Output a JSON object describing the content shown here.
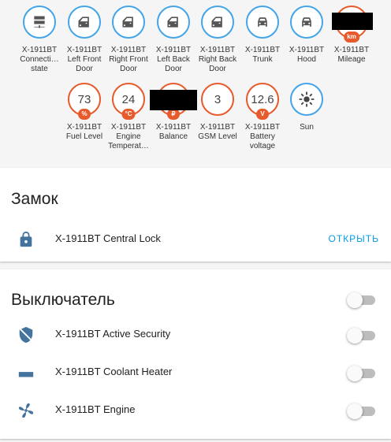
{
  "badges": [
    {
      "label": "X-1911BT Connecti… state",
      "icon": "server-icon"
    },
    {
      "label": "X-1911BT Left Front Door",
      "icon": "car-door-icon"
    },
    {
      "label": "X-1911BT Right Front Door",
      "icon": "car-door-icon"
    },
    {
      "label": "X-1911BT Left Back Door",
      "icon": "car-door-icon"
    },
    {
      "label": "X-1911BT Right Back Door",
      "icon": "car-door-icon"
    },
    {
      "label": "X-1911BT Trunk",
      "icon": "car-icon"
    },
    {
      "label": "X-1911BT Hood",
      "icon": "car-icon"
    },
    {
      "label": "X-1911BT Mileage",
      "unit": "km"
    },
    {
      "label": "X-1911BT Fuel Level",
      "value": "73",
      "unit": "%"
    },
    {
      "label": "X-1911BT Engine Temperat…",
      "value": "24",
      "unit": "°C"
    },
    {
      "label": "X-1911BT Balance",
      "unit": "₽"
    },
    {
      "label": "X-1911BT GSM Level",
      "value": "3"
    },
    {
      "label": "X-1911BT Battery voltage",
      "value": "12.6",
      "unit": "V"
    },
    {
      "label": "Sun",
      "icon": "sun-icon"
    }
  ],
  "lock_card": {
    "title": "Замок",
    "row_label": "X-1911BT Central Lock",
    "action_label": "ОТКРЫТЬ"
  },
  "switch_card": {
    "title": "Выключатель",
    "rows": [
      {
        "label": "X-1911BT Active Security",
        "on": false
      },
      {
        "label": "X-1911BT Coolant Heater",
        "on": false
      },
      {
        "label": "X-1911BT Engine",
        "on": false
      }
    ],
    "master_on": false
  },
  "colors": {
    "badge_blue": "#44a4e8",
    "badge_orange": "#e75a2b",
    "icon_blue": "#44739e",
    "accent": "#039be5"
  }
}
